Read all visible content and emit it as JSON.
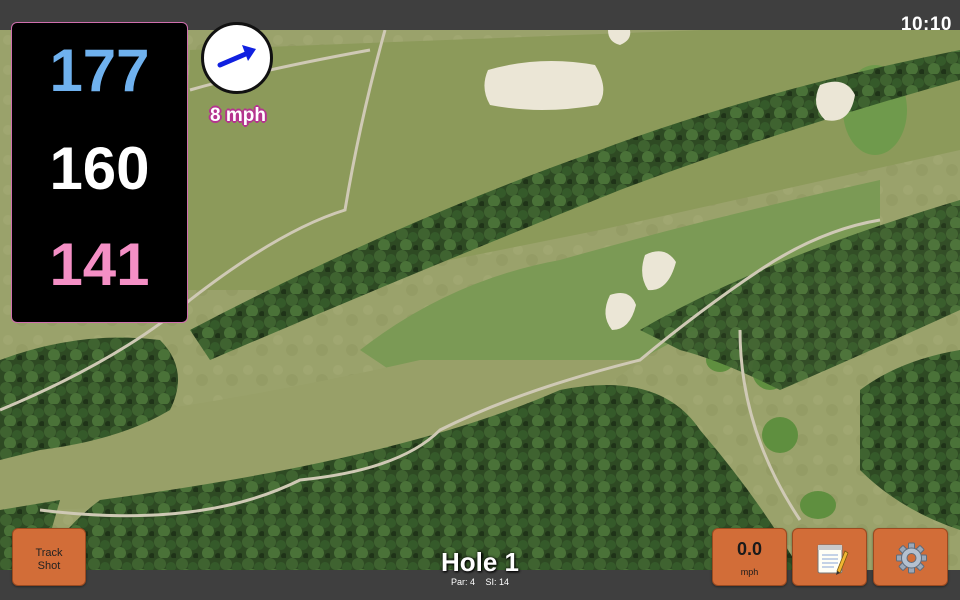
{
  "status_bar": {
    "time": "10:10"
  },
  "distances": {
    "back": "177",
    "middle": "160",
    "front": "141"
  },
  "wind": {
    "speed": "8 mph",
    "direction_icon": "wind-arrow-icon"
  },
  "hole": {
    "title": "Hole 1",
    "par": "Par: 4",
    "stroke_index": "SI: 14"
  },
  "buttons": {
    "track_shot": "Track\nShot",
    "speed_value": "0.0",
    "speed_unit": "mph",
    "notes_icon": "notepad-icon",
    "settings_icon": "gear-icon"
  },
  "colors": {
    "button": "#d26d38",
    "back_distance": "#6fb1ee",
    "middle_distance": "#ffffff",
    "front_distance": "#f48fc5",
    "panel_border": "#cf6fae"
  }
}
